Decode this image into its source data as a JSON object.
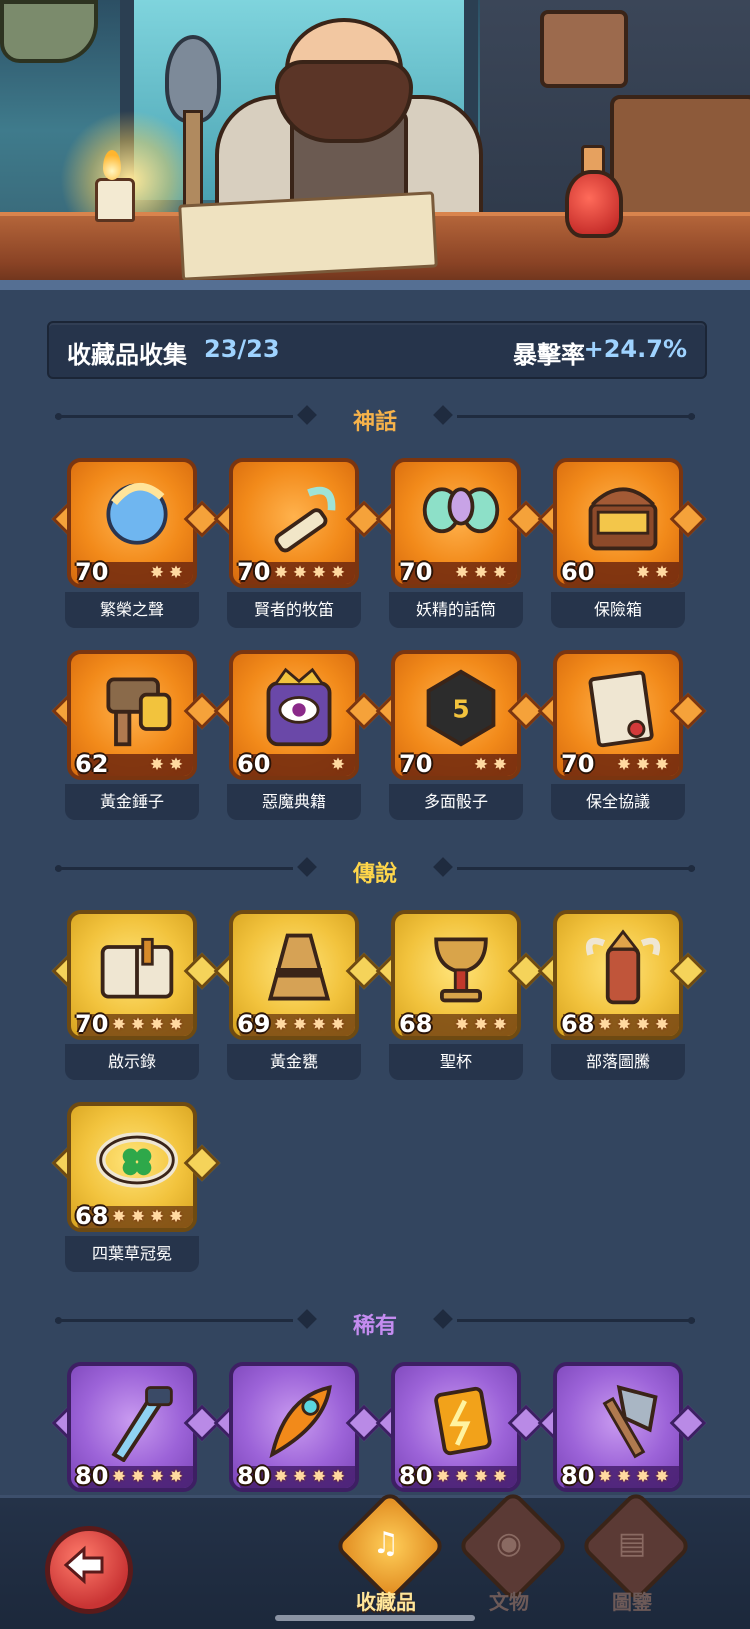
{
  "collection": {
    "title": "收藏品收集",
    "count": "23/23",
    "bonus_label": "暴擊率",
    "bonus_value": "+24.7%"
  },
  "sections": {
    "mythic": {
      "label": "神話",
      "color": "#f6b24a"
    },
    "legendary": {
      "label": "傳說",
      "color": "#ffd64a"
    },
    "rare": {
      "label": "稀有",
      "color": "#c48cf0"
    }
  },
  "mythic_items": [
    {
      "name": "繁榮之聲",
      "level": "70",
      "stars": 2
    },
    {
      "name": "賢者的牧笛",
      "level": "70",
      "stars": 4
    },
    {
      "name": "妖精的話筒",
      "level": "70",
      "stars": 3
    },
    {
      "name": "保險箱",
      "level": "60",
      "stars": 2
    },
    {
      "name": "黃金錘子",
      "level": "62",
      "stars": 2
    },
    {
      "name": "惡魔典籍",
      "level": "60",
      "stars": 1
    },
    {
      "name": "多面骰子",
      "level": "70",
      "stars": 2
    },
    {
      "name": "保全協議",
      "level": "70",
      "stars": 3
    }
  ],
  "legendary_items": [
    {
      "name": "啟示錄",
      "level": "70",
      "stars": 4
    },
    {
      "name": "黃金甕",
      "level": "69",
      "stars": 4
    },
    {
      "name": "聖杯",
      "level": "68",
      "stars": 3
    },
    {
      "name": "部落圖騰",
      "level": "68",
      "stars": 4
    },
    {
      "name": "四葉草冠冕",
      "level": "68",
      "stars": 4
    }
  ],
  "rare_items": [
    {
      "level": "80",
      "stars": 4
    },
    {
      "level": "80",
      "stars": 4
    },
    {
      "level": "80",
      "stars": 4
    },
    {
      "level": "80",
      "stars": 4
    }
  ],
  "nav": {
    "collectibles": "收藏品",
    "artifacts": "文物",
    "codex": "圖鑒"
  },
  "icons": {
    "back": "back-arrow-icon",
    "collectibles": "lyre-icon",
    "artifacts": "eye-icon",
    "codex": "book-icon"
  }
}
